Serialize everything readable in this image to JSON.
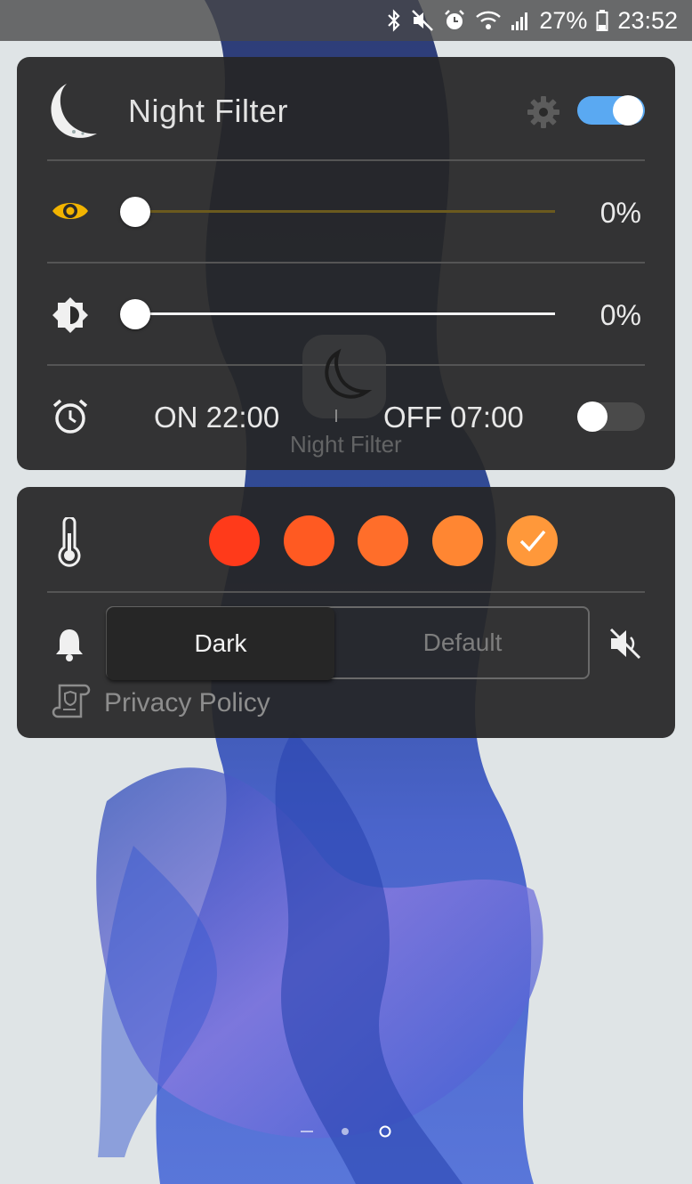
{
  "status_bar": {
    "battery": "27%",
    "time": "23:52",
    "icons": [
      "bluetooth-icon",
      "mute-icon",
      "alarm-icon",
      "wifi-icon",
      "signal-icon",
      "battery-icon"
    ]
  },
  "panel": {
    "title": "Night Filter",
    "master_toggle_on": true,
    "filter_intensity": {
      "label": "0%",
      "value": 0
    },
    "dim": {
      "label": "0%",
      "value": 0
    },
    "schedule": {
      "on": "ON 22:00",
      "off": "OFF 07:00",
      "enabled": false
    }
  },
  "colors": {
    "accent": "#5aa9f2",
    "eye_icon": "#f2b400",
    "swatches": [
      "#ff3a1a",
      "#ff5a22",
      "#ff6e2a",
      "#ff8632",
      "#ff983a"
    ],
    "selected_swatch_index": 4
  },
  "theme": {
    "dark": "Dark",
    "default": "Default",
    "selected": "Dark"
  },
  "privacy": {
    "label": "Privacy Policy"
  },
  "home_screen": {
    "app_label": "Night Filter"
  }
}
